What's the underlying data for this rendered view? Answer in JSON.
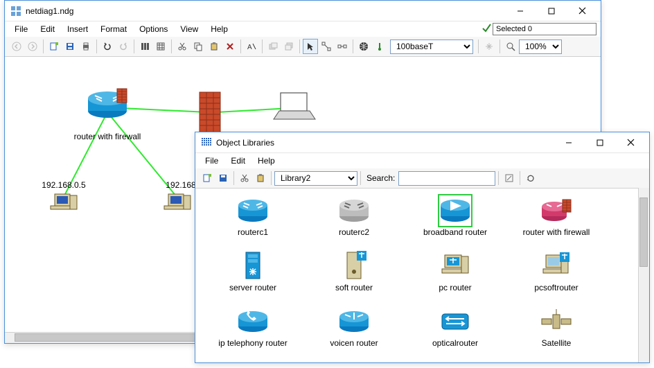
{
  "main_window": {
    "title": "netdiag1.ndg",
    "menu": [
      "File",
      "Edit",
      "Insert",
      "Format",
      "Options",
      "View",
      "Help"
    ],
    "selected_status": "Selected 0",
    "cable_type": "100baseT",
    "zoom": "100%"
  },
  "canvas": {
    "router_label": "router with firewall",
    "ip_left": "192.168.0.5",
    "ip_right": "192.168"
  },
  "library_window": {
    "title": "Object Libraries",
    "menu": [
      "File",
      "Edit",
      "Help"
    ],
    "library_selected": "Library2",
    "search_label": "Search:",
    "items": [
      {
        "name": "routerc1"
      },
      {
        "name": "routerc2"
      },
      {
        "name": "broadband router",
        "selected": true
      },
      {
        "name": "router with firewall"
      },
      {
        "name": "server router"
      },
      {
        "name": "soft router"
      },
      {
        "name": "pc router"
      },
      {
        "name": "pcsoftrouter"
      },
      {
        "name": "ip telephony router"
      },
      {
        "name": "voicen router"
      },
      {
        "name": "opticalrouter"
      },
      {
        "name": "Satellite"
      }
    ]
  }
}
